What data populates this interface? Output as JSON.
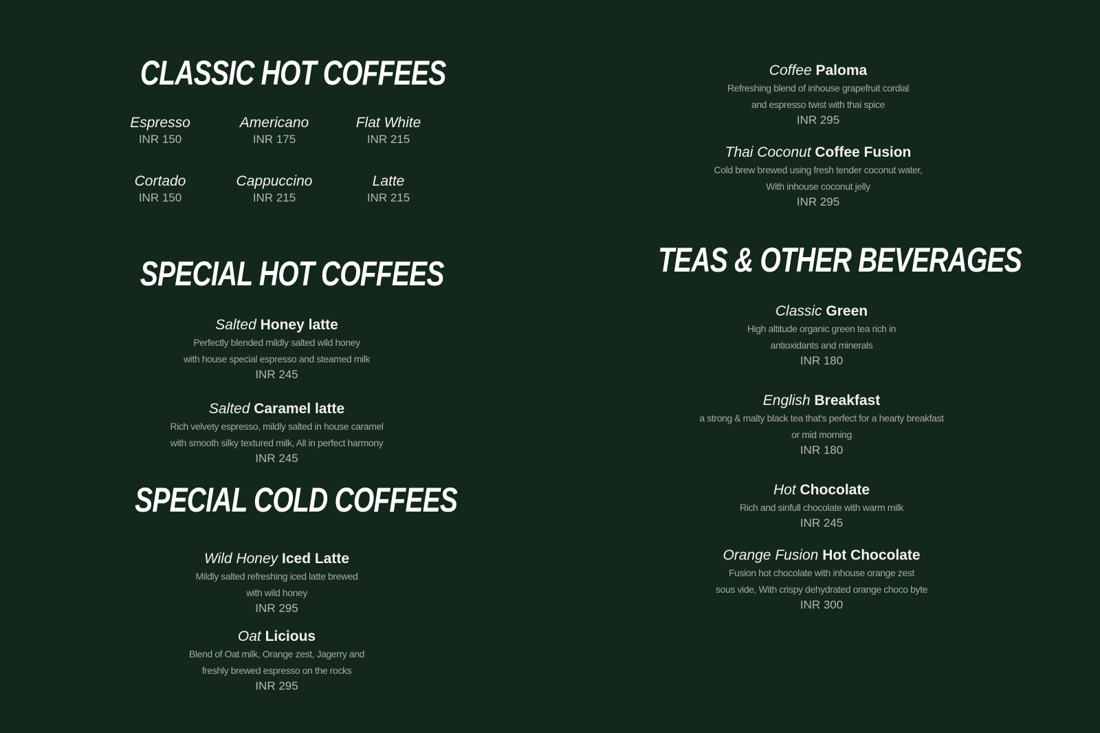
{
  "sections": {
    "classic_hot": {
      "title": "CLASSIC HOT COFFEES",
      "items": [
        {
          "name": "Espresso",
          "price": "INR 150"
        },
        {
          "name": "Americano",
          "price": "INR 175"
        },
        {
          "name": "Flat White",
          "price": "INR 215"
        },
        {
          "name": "Cortado",
          "price": "INR 150"
        },
        {
          "name": "Cappuccino",
          "price": "INR 215"
        },
        {
          "name": "Latte",
          "price": "INR 215"
        }
      ]
    },
    "special_hot": {
      "title": "SPECIAL HOT COFFEES",
      "items": [
        {
          "name_light": "Salted",
          "name_bold": "Honey latte",
          "desc1": "Perfectly blended mildly salted wild honey",
          "desc2": "with house special espresso and steamed milk",
          "price": "INR 245"
        },
        {
          "name_light": "Salted",
          "name_bold": "Caramel latte",
          "desc1": "Rich velvety espresso, mildly salted in house caramel",
          "desc2": "with smooth silky textured milk, All in perfect harmony",
          "price": "INR 245"
        }
      ]
    },
    "special_cold": {
      "title": "SPECIAL COLD COFFEES",
      "items": [
        {
          "name_light": "Wild Honey",
          "name_bold": "Iced Latte",
          "desc1": "Mildly salted refreshing iced latte brewed",
          "desc2": "with wild honey",
          "price": "INR 295"
        },
        {
          "name_light": "Oat",
          "name_bold": "Licious",
          "desc1": "Blend of Oat milk, Orange zest, Jagerry and",
          "desc2": "freshly brewed espresso on the rocks",
          "price": "INR 295"
        },
        {
          "name_light": "Coffee",
          "name_bold": "Paloma",
          "desc1": "Refreshing blend of inhouse grapefruit cordial",
          "desc2": "and espresso twist with thai spice",
          "price": "INR 295"
        },
        {
          "name_light": "Thai Coconut",
          "name_bold": "Coffee Fusion",
          "desc1": "Cold brew brewed using fresh tender coconut water,",
          "desc2": "With inhouse coconut jelly",
          "price": "INR 295"
        }
      ]
    },
    "teas": {
      "title": "TEAS & OTHER BEVERAGES",
      "items": [
        {
          "name_light": "Classic",
          "name_bold": "Green",
          "desc1": "High altitude organic green tea rich in",
          "desc2": "antioxidants and minerals",
          "price": "INR 180"
        },
        {
          "name_light": "English",
          "name_bold": "Breakfast",
          "desc1": "a strong & malty black tea that's perfect for a hearty breakfast",
          "desc2": "or mid morning",
          "price": "INR 180"
        },
        {
          "name_light": "Hot",
          "name_bold": "Chocolate",
          "desc1": "Rich and sinfull chocolate with warm milk",
          "price": "INR 245"
        },
        {
          "name_light": "Orange Fusion",
          "name_bold": "Hot Chocolate",
          "desc1": "Fusion hot chocolate with inhouse orange zest",
          "desc2": "sous vide, With crispy dehydrated orange choco byte",
          "price": "INR 300"
        }
      ]
    }
  },
  "colors": {
    "background": "#13271a",
    "title": "#ffffff",
    "item_name": "#f4f2ea",
    "price": "#b4b9b1",
    "description": "#a5ab9f"
  }
}
